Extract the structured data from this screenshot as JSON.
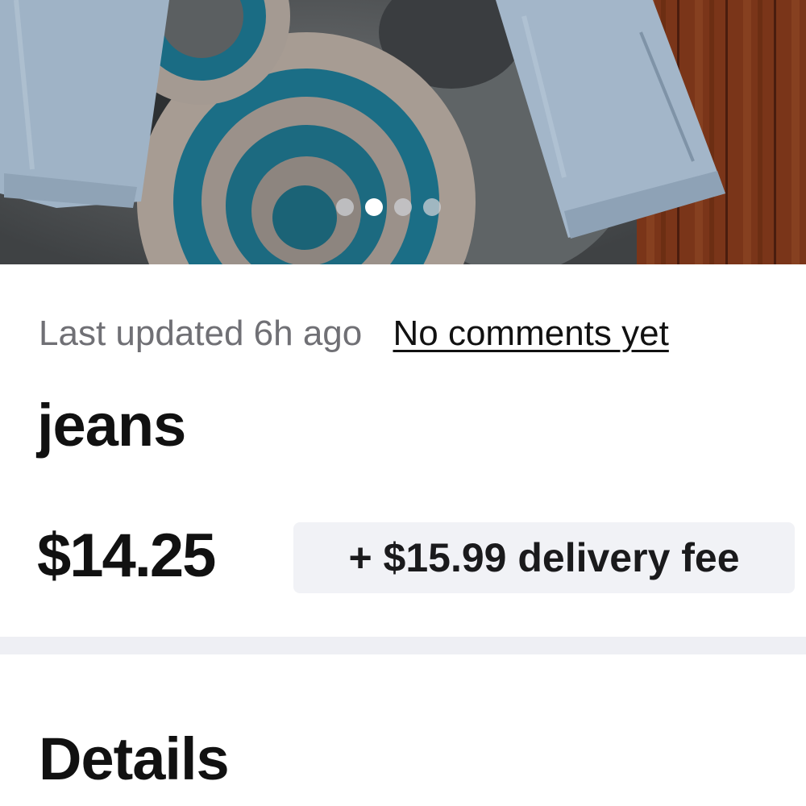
{
  "listing": {
    "last_updated": "Last updated 6h ago",
    "comments_link": "No comments yet",
    "title": "jeans",
    "price": "$14.25",
    "delivery_fee": "+ $15.99 delivery fee"
  },
  "carousel": {
    "image_description_icon": "listing-photo",
    "total_images": 4,
    "active_index": 1
  },
  "sections": {
    "details_heading": "Details"
  },
  "colors": {
    "fee_badge_bg": "#f1f2f6",
    "divider": "#eeeff4",
    "muted_text": "#707075"
  }
}
